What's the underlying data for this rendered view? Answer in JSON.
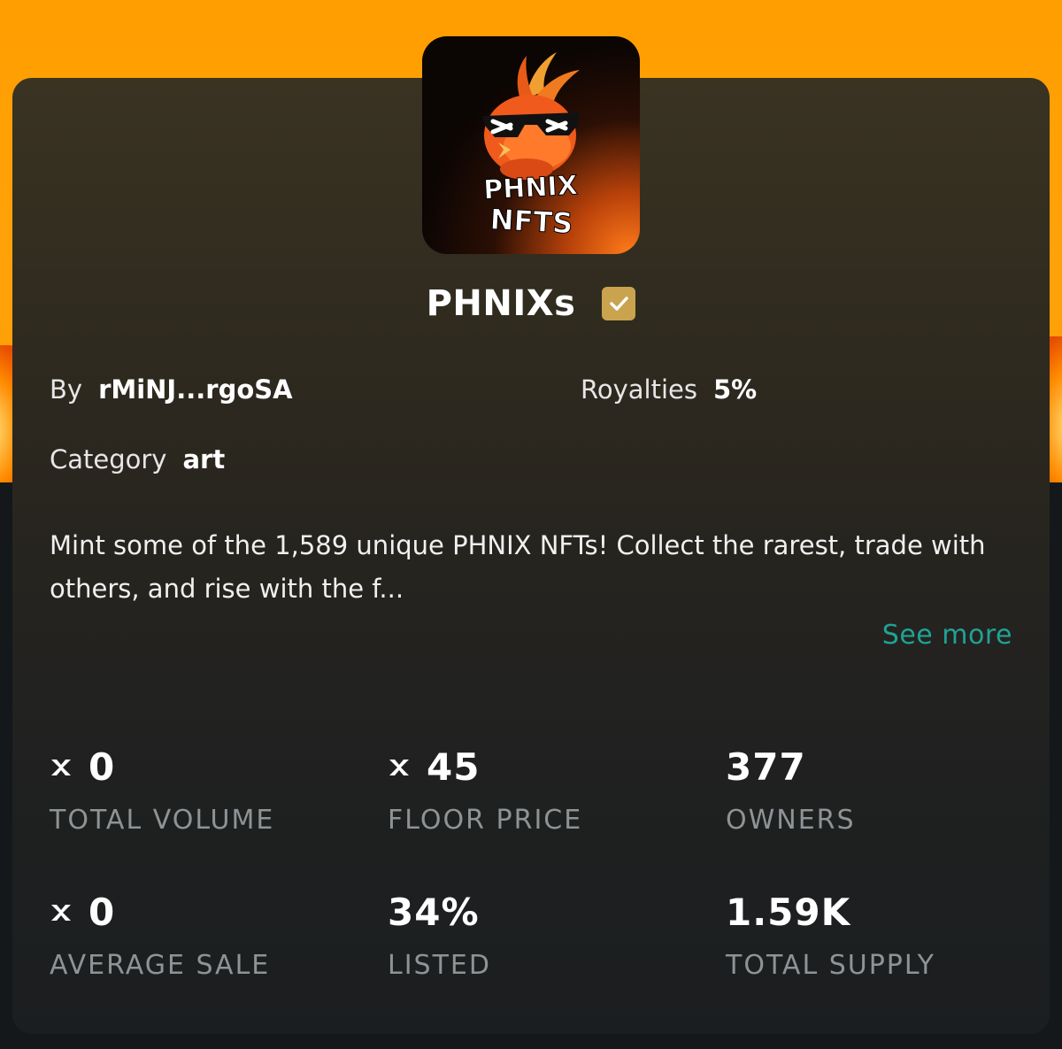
{
  "collection": {
    "name": "PHNIXs",
    "verified": true,
    "logo_text": [
      "PHNIX",
      "NFTS"
    ]
  },
  "info": {
    "by_label": "By",
    "by_value": "rMiNJ...rgoSA",
    "royalties_label": "Royalties",
    "royalties_value": "5%",
    "category_label": "Category",
    "category_value": "art"
  },
  "description": "Mint some of the 1,589 unique PHNIX NFTs! Collect the rarest, trade with others, and rise with the f...",
  "see_more_label": "See more",
  "stats": [
    {
      "value": "0",
      "label": "TOTAL VOLUME",
      "xrp_icon": true
    },
    {
      "value": "45",
      "label": "FLOOR PRICE",
      "xrp_icon": true
    },
    {
      "value": "377",
      "label": "OWNERS",
      "xrp_icon": false
    },
    {
      "value": "0",
      "label": "AVERAGE SALE",
      "xrp_icon": true
    },
    {
      "value": "34%",
      "label": "LISTED",
      "xrp_icon": false
    },
    {
      "value": "1.59K",
      "label": "TOTAL SUPPLY",
      "xrp_icon": false
    }
  ],
  "colors": {
    "banner": "#ffa20a",
    "accent_link": "#1fa394",
    "verified_badge": "#c9a34e",
    "stat_label": "#8e9396"
  },
  "icons": {
    "currency": "xrp-icon",
    "verified": "checkmark-icon"
  }
}
